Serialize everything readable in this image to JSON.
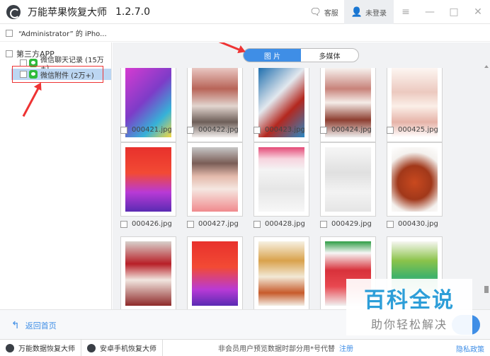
{
  "window": {
    "title": "万能苹果恢复大师",
    "version": "1.2.7.0",
    "support_label": "客服",
    "login_label": "未登录"
  },
  "device": {
    "label": "“Administrator” 的 iPho..."
  },
  "sidebar": {
    "root_label": "第三方APP",
    "items": [
      {
        "label": "微信聊天记录 (15万+)"
      },
      {
        "label": "微信附件 (2万+)"
      }
    ]
  },
  "tabs": [
    {
      "label": "图  片"
    },
    {
      "label": "多媒体"
    }
  ],
  "thumbnails": [
    {
      "filename": "000421.jpg"
    },
    {
      "filename": "000422.jpg"
    },
    {
      "filename": "000423.jpg"
    },
    {
      "filename": "000424.jpg"
    },
    {
      "filename": "000425.jpg"
    },
    {
      "filename": "000426.jpg"
    },
    {
      "filename": "000427.jpg"
    },
    {
      "filename": "000428.jpg"
    },
    {
      "filename": "000429.jpg"
    },
    {
      "filename": "000430.jpg"
    },
    {
      "filename": ""
    },
    {
      "filename": ""
    },
    {
      "filename": ""
    },
    {
      "filename": ""
    },
    {
      "filename": ""
    }
  ],
  "actionbar": {
    "back_label": "返回首页"
  },
  "statusbar": {
    "item1": "万能数据恢复大师",
    "item2": "安卓手机恢复大师",
    "note": "非会员用户预览数据时部分用*号代替",
    "register": "注册",
    "policy": "隐私政策"
  },
  "watermark": {
    "main": "百科全说",
    "sub": "助你轻松解决"
  },
  "colors": {
    "accent": "#3f8ee6",
    "annotation": "#ee3333",
    "wechat": "#2dbb3b",
    "selected_row": "#bcd6f2"
  }
}
